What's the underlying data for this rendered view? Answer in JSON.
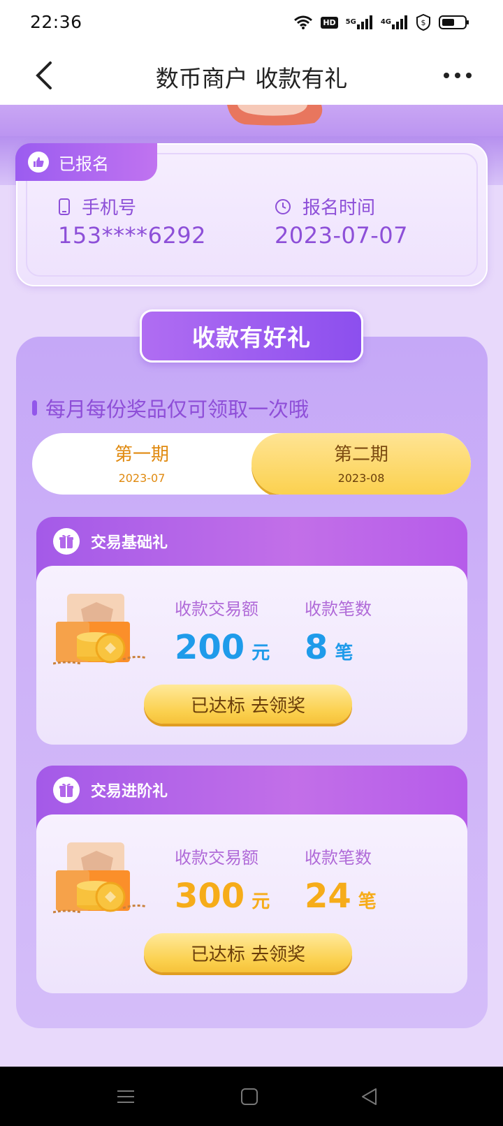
{
  "status_bar": {
    "time": "22:36",
    "icons": [
      "wifi-icon",
      "hd-icon",
      "signal-5g-icon",
      "signal-4g-icon",
      "shield-dollar-icon",
      "battery-icon"
    ],
    "hd_label": "HD",
    "net_5g": "5G",
    "net_4g": "4G"
  },
  "nav": {
    "title": "数币商户 收款有礼"
  },
  "registration": {
    "badge": "已报名",
    "phone_label": "手机号",
    "phone_value": "153****6292",
    "time_label": "报名时间",
    "time_value": "2023-07-07"
  },
  "gift_section": {
    "title": "收款有好礼",
    "note": "每月每份奖品仅可领取一次哦",
    "periods": [
      {
        "name": "第一期",
        "date": "2023-07",
        "selected": false
      },
      {
        "name": "第二期",
        "date": "2023-08",
        "selected": true
      }
    ],
    "cards": [
      {
        "title": "交易基础礼",
        "amount_label": "收款交易额",
        "amount_value": "200",
        "amount_unit": "元",
        "count_label": "收款笔数",
        "count_value": "8",
        "count_unit": "笔",
        "button": "已达标 去领奖",
        "accent": "#1f9bea"
      },
      {
        "title": "交易进阶礼",
        "amount_label": "收款交易额",
        "amount_value": "300",
        "amount_unit": "元",
        "count_label": "收款笔数",
        "count_value": "24",
        "count_unit": "笔",
        "button": "已达标 去领奖",
        "accent": "#f6ac19"
      }
    ]
  },
  "colors": {
    "brand_purple": "#9b5cf0",
    "gold": "#fbd14f",
    "blue_value": "#1f9bea",
    "orange_value": "#f6ac19"
  }
}
